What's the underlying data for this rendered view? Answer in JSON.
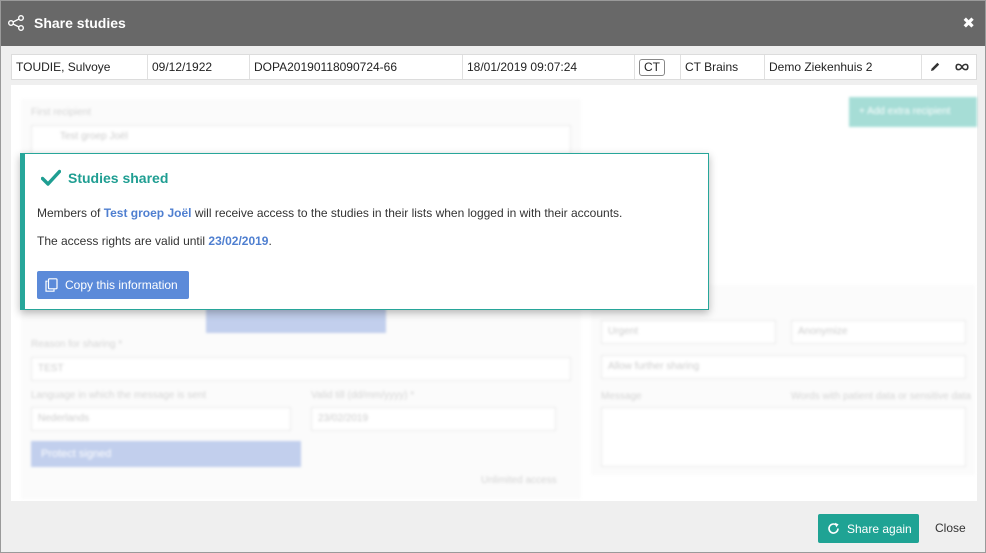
{
  "window": {
    "title": "Share studies",
    "close_symbol": "✖"
  },
  "study": {
    "patient": "TOUDIE, Sulvoye",
    "birth_date": "09/12/1922",
    "accession": "DOPA20190118090724-66",
    "study_datetime": "18/01/2019 09:07:24",
    "modality": "CT",
    "description": "CT Brains",
    "institution": "Demo Ziekenhuis 2"
  },
  "background_form": {
    "first_recipient_label": "First recipient",
    "recipient_name": "Test groep Joël",
    "add_recipient_label": "+ Add extra recipient",
    "reason_label": "Reason for sharing *",
    "reason_value": "TEST",
    "language_label": "Language in which the message is sent",
    "language_value": "Nederlands",
    "valid_label": "Valid till (dd/mm/yyyy) *",
    "valid_value": "23/02/2019",
    "protect_label": "Protect signed",
    "unlimited_label": "Unlimited access",
    "urgent_label": "Urgent",
    "anonymize_label": "Anonymize",
    "allow_label": "Allow further sharing",
    "message_label": "Message",
    "message_hint": "Words with patient data or sensitive data"
  },
  "popup": {
    "heading": "Studies shared",
    "line1_prefix": "Members of ",
    "line1_group": "Test groep Joël",
    "line1_suffix": " will receive access to the studies in their lists when logged in with their accounts.",
    "line2_prefix": "The access rights are valid until ",
    "line2_date": "23/02/2019",
    "line2_suffix": ".",
    "copy_button": "Copy this information"
  },
  "footer": {
    "share_again": "Share again",
    "close": "Close"
  },
  "colors": {
    "teal": "#1fa394",
    "blue": "#5b8ad9",
    "titlebar": "#686868"
  }
}
